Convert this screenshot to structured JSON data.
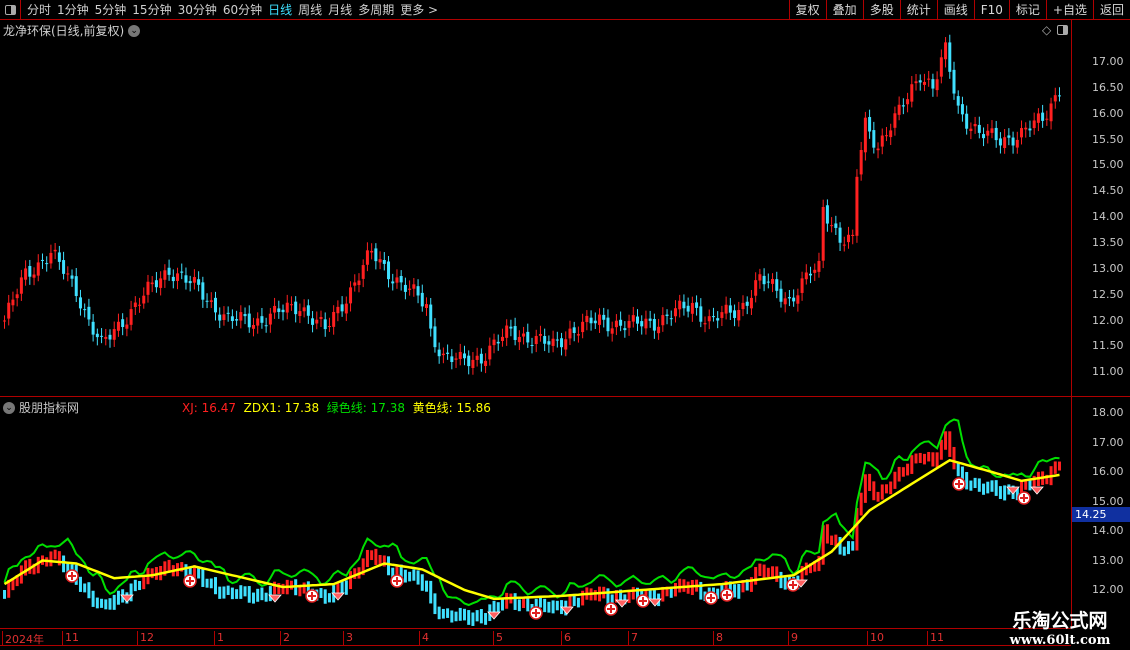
{
  "toolbar": {
    "periods": [
      "分时",
      "1分钟",
      "5分钟",
      "15分钟",
      "30分钟",
      "60分钟",
      "日线",
      "周线",
      "月线",
      "多周期",
      "更多 >"
    ],
    "active": "日线",
    "right_buttons": [
      "复权",
      "叠加",
      "多股",
      "统计",
      "画线",
      "F10",
      "标记",
      "+自选",
      "返回"
    ]
  },
  "main": {
    "title": "龙净环保(日线,前复权)",
    "price_labels": [
      "17.00",
      "16.50",
      "16.00",
      "15.50",
      "15.00",
      "14.50",
      "14.00",
      "13.50",
      "13.00",
      "12.50",
      "12.00",
      "11.50",
      "11.00"
    ]
  },
  "indicator": {
    "title": "股朋指标网",
    "xj_label": "XJ: 16.47",
    "zdx1_label": "ZDX1: 17.38",
    "green_label": "绿色线: 17.38",
    "yellow_label": "黄色线: 15.86",
    "axis_labels": [
      "18.00",
      "17.00",
      "16.00",
      "15.00",
      "14.00",
      "13.00",
      "12.00"
    ],
    "current_value": "14.25"
  },
  "date_axis": [
    "2024年",
    "11",
    "12",
    "1",
    "2",
    "3",
    "4",
    "5",
    "6",
    "7",
    "8",
    "9",
    "10",
    "11"
  ],
  "watermark": {
    "line1": "乐淘公式网",
    "line2": "www.60lt.com"
  },
  "colors": {
    "up": "#ff2020",
    "down": "#40e0ff",
    "yellow_line": "#ffff00",
    "green_line": "#00e000",
    "border": "#b00000"
  },
  "chart_data": {
    "type": "candlestick",
    "note_units": "price (CNY)",
    "close_path": [
      [
        0,
        12.0
      ],
      [
        5,
        12.9
      ],
      [
        11,
        13.3
      ],
      [
        17,
        12.6
      ],
      [
        20,
        12.0
      ],
      [
        23,
        11.5
      ],
      [
        30,
        12.2
      ],
      [
        39,
        13.0
      ],
      [
        46,
        12.6
      ],
      [
        53,
        12.0
      ],
      [
        60,
        12.0
      ],
      [
        70,
        12.3
      ],
      [
        76,
        11.8
      ],
      [
        82,
        12.6
      ],
      [
        87,
        13.3
      ],
      [
        94,
        12.7
      ],
      [
        100,
        12.3
      ],
      [
        101,
        11.8
      ],
      [
        104,
        11.3
      ],
      [
        108,
        11.2
      ],
      [
        113,
        11.3
      ],
      [
        120,
        11.8
      ],
      [
        130,
        11.5
      ],
      [
        134,
        11.8
      ],
      [
        141,
        12.0
      ],
      [
        148,
        11.9
      ],
      [
        155,
        12.0
      ],
      [
        163,
        12.3
      ],
      [
        167,
        12.0
      ],
      [
        174,
        12.2
      ],
      [
        179,
        12.8
      ],
      [
        186,
        12.4
      ],
      [
        191,
        12.9
      ],
      [
        193,
        13.0
      ],
      [
        194,
        14.2
      ],
      [
        198,
        13.6
      ],
      [
        201,
        13.5
      ],
      [
        202,
        14.8
      ],
      [
        204,
        15.8
      ],
      [
        207,
        15.4
      ],
      [
        212,
        16.0
      ],
      [
        217,
        16.8
      ],
      [
        220,
        16.5
      ],
      [
        223,
        17.2
      ],
      [
        226,
        16.1
      ],
      [
        231,
        15.6
      ],
      [
        236,
        15.5
      ],
      [
        241,
        15.6
      ],
      [
        246,
        15.9
      ],
      [
        250,
        16.5
      ]
    ],
    "yellow_line": [
      [
        0,
        12.2
      ],
      [
        9,
        13.0
      ],
      [
        17,
        12.9
      ],
      [
        26,
        12.4
      ],
      [
        35,
        12.5
      ],
      [
        45,
        12.8
      ],
      [
        54,
        12.5
      ],
      [
        66,
        12.1
      ],
      [
        78,
        12.2
      ],
      [
        90,
        12.9
      ],
      [
        99,
        12.7
      ],
      [
        109,
        12.0
      ],
      [
        116,
        11.7
      ],
      [
        132,
        11.8
      ],
      [
        151,
        12.0
      ],
      [
        170,
        12.2
      ],
      [
        187,
        12.5
      ],
      [
        196,
        13.3
      ],
      [
        205,
        14.7
      ],
      [
        215,
        15.6
      ],
      [
        224,
        16.4
      ],
      [
        234,
        16.0
      ],
      [
        241,
        15.7
      ],
      [
        250,
        15.9
      ]
    ]
  }
}
